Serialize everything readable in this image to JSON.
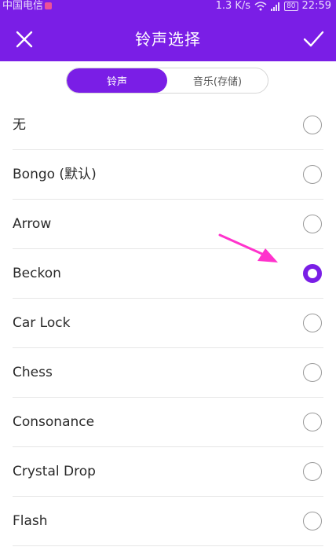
{
  "status_bar": {
    "carrier": "中国电信",
    "speed": "1.3 K/s",
    "battery": "80",
    "time": "22:59"
  },
  "header": {
    "title": "铃声选择",
    "close_icon": "close-icon",
    "confirm_icon": "check-icon"
  },
  "tabs": [
    {
      "label": "铃声",
      "active": true
    },
    {
      "label": "音乐(存储)",
      "active": false
    }
  ],
  "ringtones": [
    {
      "label": "无",
      "selected": false
    },
    {
      "label": "Bongo (默认)",
      "selected": false
    },
    {
      "label": "Arrow",
      "selected": false
    },
    {
      "label": "Beckon",
      "selected": true
    },
    {
      "label": "Car Lock",
      "selected": false
    },
    {
      "label": "Chess",
      "selected": false
    },
    {
      "label": "Consonance",
      "selected": false
    },
    {
      "label": "Crystal Drop",
      "selected": false
    },
    {
      "label": "Flash",
      "selected": false
    }
  ],
  "colors": {
    "accent": "#7a1ee6",
    "annotation_arrow": "#ff33cc"
  }
}
